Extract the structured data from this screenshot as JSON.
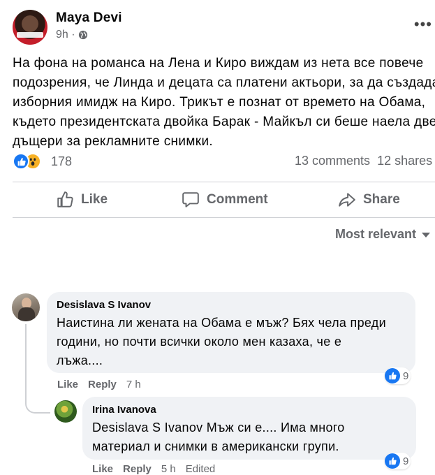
{
  "post": {
    "author": "Maya Devi",
    "time": "9h ·",
    "more_label": "•••",
    "text_lines": [
      "На фона на романса на Лена и Киро виждам из нета все повече",
      "подозрения, че Линда и децата са платени актьори, за да създадат",
      "изборния имидж на Киро. Трикът е познат от времето на Обама,",
      "където президентската двойка Барак - Майкъл си беше наела две",
      "дъщери за рекламните снимки."
    ],
    "reaction_count": "178",
    "comments_count": "13 comments",
    "shares_count": "12 shares"
  },
  "actions": {
    "like": "Like",
    "comment": "Comment",
    "share": "Share"
  },
  "sort": {
    "label": "Most relevant"
  },
  "comments": [
    {
      "author": "Desislava S Ivanov",
      "text_lines": [
        "Наистина ли жената на Обама е мъж? Бях чела преди",
        "години, но почти всички около мен казаха, че е",
        "лъжа...."
      ],
      "like": "Like",
      "reply": "Reply",
      "time": "7 h",
      "reaction_count": "9"
    },
    {
      "author": "Irina Ivanova",
      "text_lines": [
        "Desislava S Ivanov Мъж си е.... Има много",
        "материал и снимки в американски групи."
      ],
      "like": "Like",
      "reply": "Reply",
      "time": "5 h",
      "edited": "Edited",
      "reaction_count": "9"
    }
  ],
  "icons": {
    "globe": "globe-icon",
    "like": "thumbs-up-icon",
    "comment": "speech-bubble-icon",
    "share": "share-arrow-icon",
    "wow": "wow-reaction-icon"
  },
  "colors": {
    "like_blue": "#1877f2",
    "wow_yellow": "#f7b125",
    "secondary_text": "#65676b",
    "bubble_bg": "#f0f2f5"
  }
}
